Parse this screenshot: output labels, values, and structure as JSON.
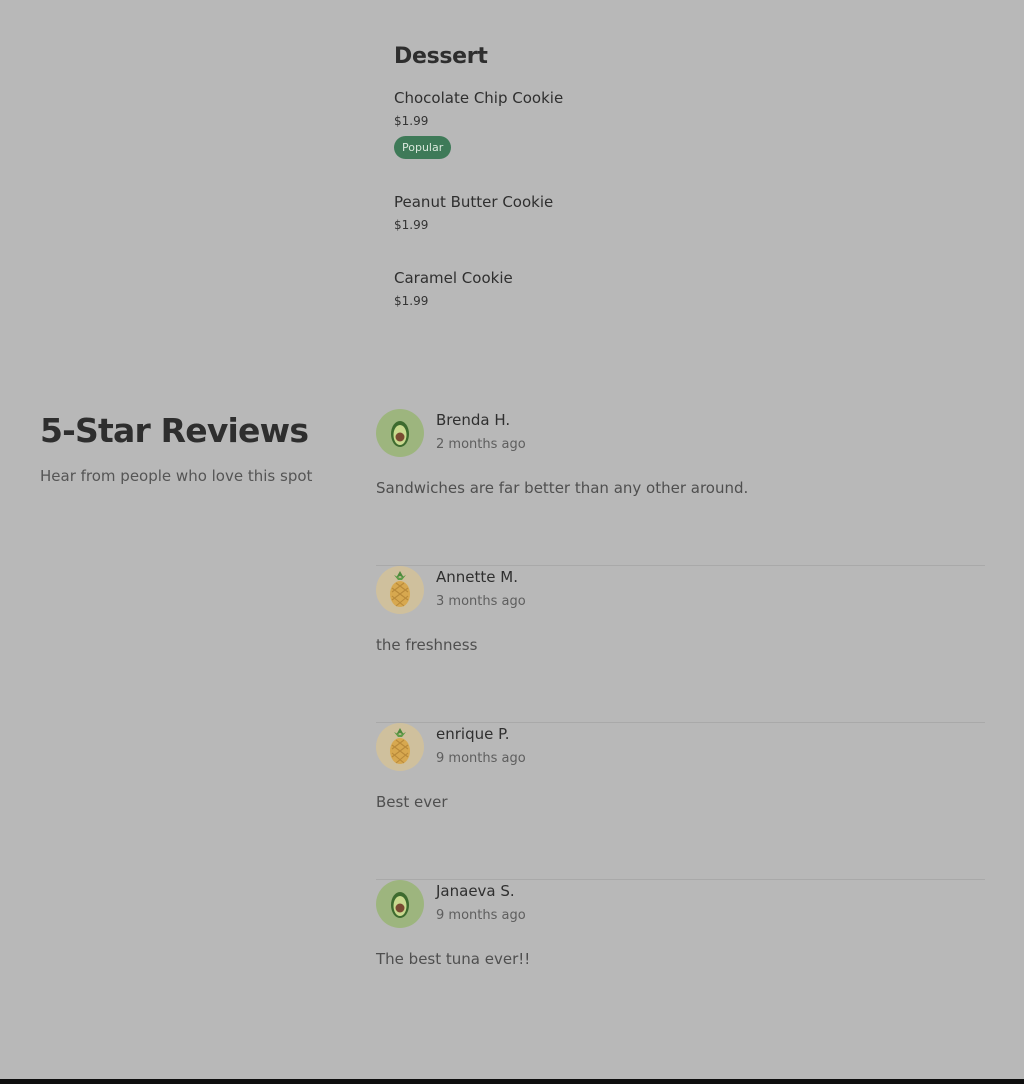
{
  "dessert": {
    "title": "Dessert",
    "items": [
      {
        "name": "Chocolate Chip Cookie",
        "price": "$1.99",
        "badge": "Popular"
      },
      {
        "name": "Peanut Butter Cookie",
        "price": "$1.99"
      },
      {
        "name": "Caramel Cookie",
        "price": "$1.99"
      }
    ]
  },
  "reviews": {
    "title": "5-Star Reviews",
    "subtitle": "Hear from people who love this spot",
    "items": [
      {
        "name": "Brenda H.",
        "time": "2 months ago",
        "text": "Sandwiches are far better than any other around.",
        "avatar": "avocado-icon"
      },
      {
        "name": "Annette M.",
        "time": "3 months ago",
        "text": "the freshness",
        "avatar": "pineapple-icon"
      },
      {
        "name": "enrique P.",
        "time": "9 months ago",
        "text": "Best ever",
        "avatar": "pineapple-icon"
      },
      {
        "name": "Janaeva S.",
        "time": "9 months ago",
        "text": "The best tuna ever!!",
        "avatar": "avocado-icon"
      }
    ]
  },
  "colors": {
    "overlay_background": "#b8b8b8",
    "badge_background": "#3e7a58",
    "avocado_avatar_bg": "#9db57e",
    "pineapple_avatar_bg": "#cfc09d"
  }
}
